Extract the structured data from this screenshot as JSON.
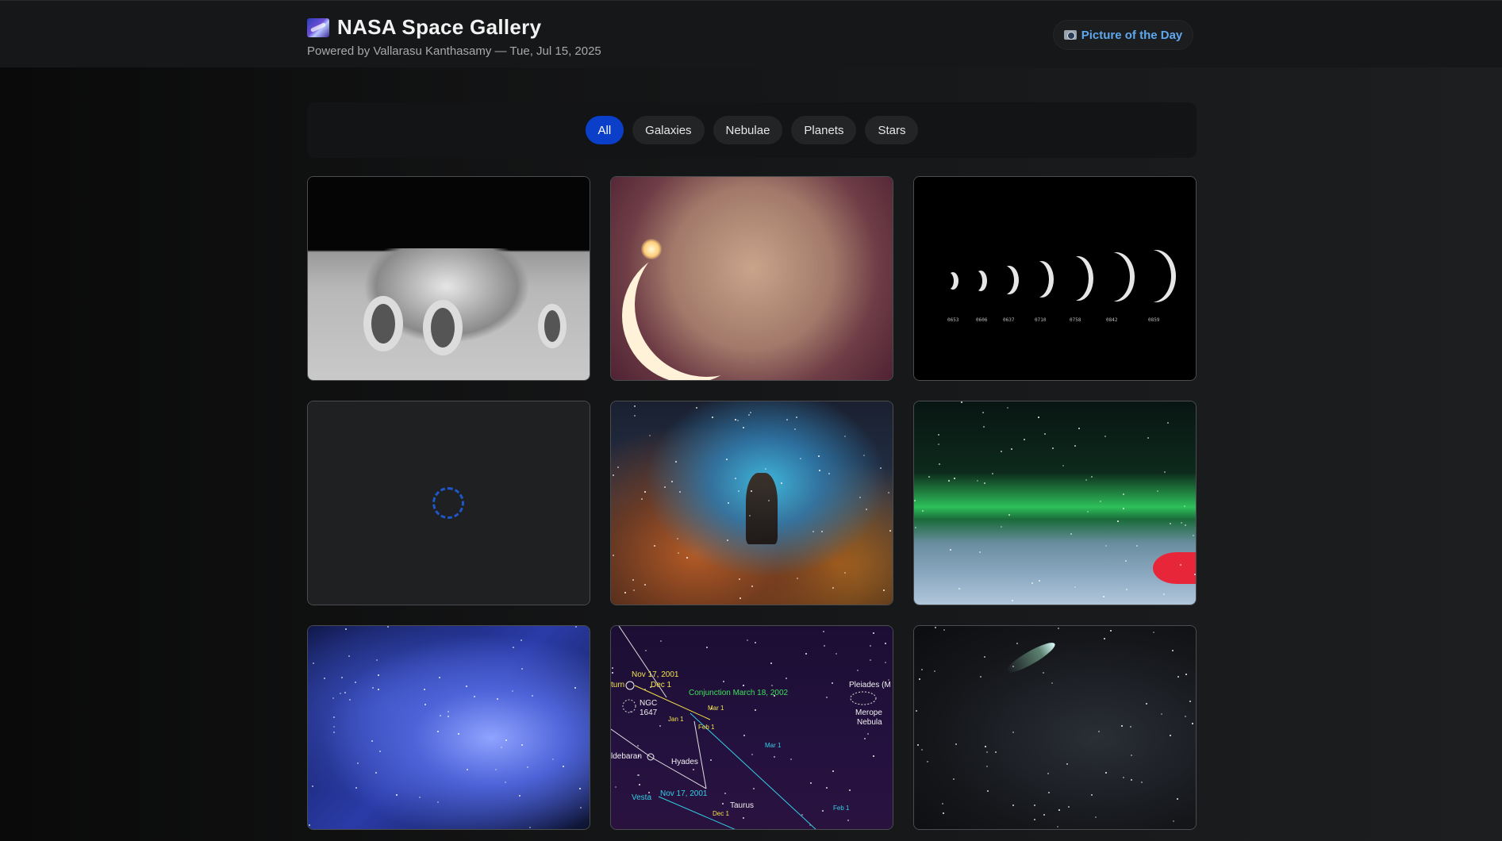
{
  "header": {
    "logo_icon": "milky-way-icon",
    "title": "NASA Space Gallery",
    "subtitle": "Powered by Vallarasu Kanthasamy — Tue, Jul 15, 2025",
    "potd_icon": "camera-icon",
    "potd_label": "Picture of the Day"
  },
  "filters": [
    {
      "label": "All",
      "active": true
    },
    {
      "label": "Galaxies",
      "active": false
    },
    {
      "label": "Nebulae",
      "active": false
    },
    {
      "label": "Planets",
      "active": false
    },
    {
      "label": "Stars",
      "active": false
    }
  ],
  "colors": {
    "accent": "#0b3fc9",
    "link": "#5fa8ee",
    "spinner": "#1f56c8"
  },
  "gallery": {
    "phase_labels": [
      "0653",
      "0606",
      "0637",
      "0710",
      "0758",
      "0842",
      "0859"
    ],
    "star_chart_labels": {
      "nov17_top": "Nov 17, 2001",
      "dec1_top": "Dec 1",
      "saturn": "turn",
      "conjunction": "Conjunction March 18, 2002",
      "pleiades": "Pleiades (M",
      "ngc": "NGC",
      "ngc_num": "1647",
      "mar1_y": "Mar 1",
      "jan1": "Jan 1",
      "feb1_y": "Feb 1",
      "merope": "Merope",
      "nebula": "Nebula",
      "mar1_c": "Mar 1",
      "aldebaran": "ldebaran",
      "hyades": "Hyades",
      "nov17_bottom": "Nov 17, 2001",
      "vesta": "Vesta",
      "taurus": "Taurus",
      "dec1_bottom": "Dec 1",
      "feb1_c": "Feb 1"
    }
  }
}
